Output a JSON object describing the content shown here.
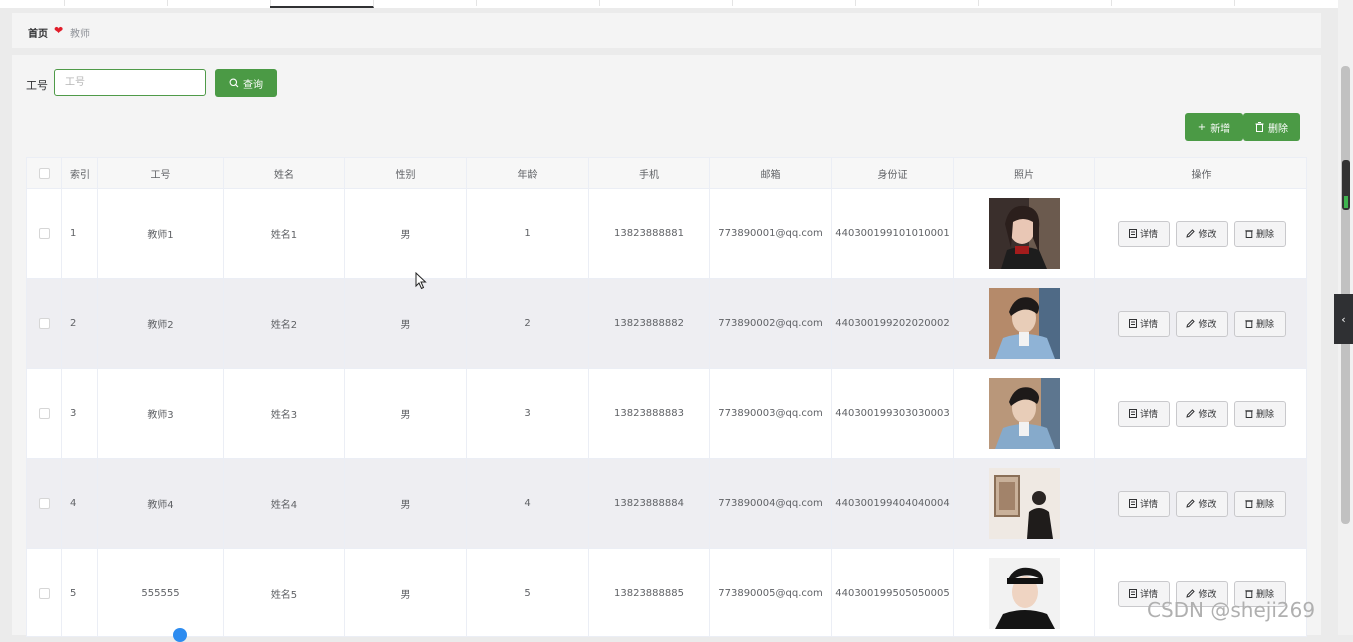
{
  "breadcrumb": {
    "home": "首页",
    "current": "教师"
  },
  "search": {
    "label": "工号",
    "placeholder": "工号",
    "value": "",
    "button": "查询"
  },
  "toolbar": {
    "add": "新增",
    "delete": "删除"
  },
  "table": {
    "columns": [
      "索引",
      "工号",
      "姓名",
      "性别",
      "年龄",
      "手机",
      "邮箱",
      "身份证",
      "照片",
      "操作"
    ],
    "rows": [
      {
        "index": "1",
        "id": "教师1",
        "name": "姓名1",
        "gender": "男",
        "age": "1",
        "phone": "13823888881",
        "email": "773890001@qq.com",
        "id_card": "440300199101010001"
      },
      {
        "index": "2",
        "id": "教师2",
        "name": "姓名2",
        "gender": "男",
        "age": "2",
        "phone": "13823888882",
        "email": "773890002@qq.com",
        "id_card": "440300199202020002"
      },
      {
        "index": "3",
        "id": "教师3",
        "name": "姓名3",
        "gender": "男",
        "age": "3",
        "phone": "13823888883",
        "email": "773890003@qq.com",
        "id_card": "440300199303030003"
      },
      {
        "index": "4",
        "id": "教师4",
        "name": "姓名4",
        "gender": "男",
        "age": "4",
        "phone": "13823888884",
        "email": "773890004@qq.com",
        "id_card": "440300199404040004"
      },
      {
        "index": "5",
        "id": "555555",
        "name": "姓名5",
        "gender": "男",
        "age": "5",
        "phone": "13823888885",
        "email": "773890005@qq.com",
        "id_card": "440300199505050005"
      }
    ],
    "actions": {
      "detail": "详情",
      "edit": "修改",
      "remove": "删除"
    }
  },
  "watermark": "CSDN @sheji269",
  "colors": {
    "primary": "#4b9a45",
    "heart": "#e11d2a",
    "stripe": "#eeeef2"
  }
}
